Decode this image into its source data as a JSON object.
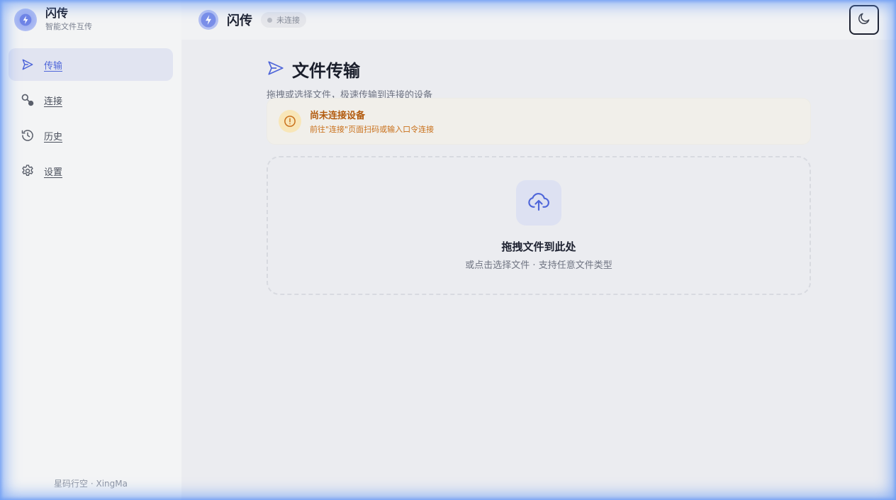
{
  "app": {
    "name": "闪传",
    "subtitle": "智能文件互传"
  },
  "sidebar": {
    "items": [
      {
        "label": "传输",
        "icon": "send-icon",
        "active": true
      },
      {
        "label": "连接",
        "icon": "link-nodes-icon",
        "active": false
      },
      {
        "label": "历史",
        "icon": "history-icon",
        "active": false
      },
      {
        "label": "设置",
        "icon": "gear-icon",
        "active": false
      }
    ],
    "footer": "星码行空 · XingMa"
  },
  "header": {
    "title": "闪传",
    "status": "未连接",
    "theme_toggle_icon": "moon-icon"
  },
  "main": {
    "title": "文件传输",
    "subtitle": "拖拽或选择文件，极速传输到连接的设备",
    "alert": {
      "title": "尚未连接设备",
      "description": "前往\"连接\"页面扫码或输入口令连接"
    },
    "dropzone": {
      "title": "拖拽文件到此处",
      "subtitle": "或点击选择文件 · 支持任意文件类型"
    }
  },
  "colors": {
    "accent": "#4f66d9",
    "warning": "#b25a0d",
    "frame_glow": "#6096f5"
  }
}
